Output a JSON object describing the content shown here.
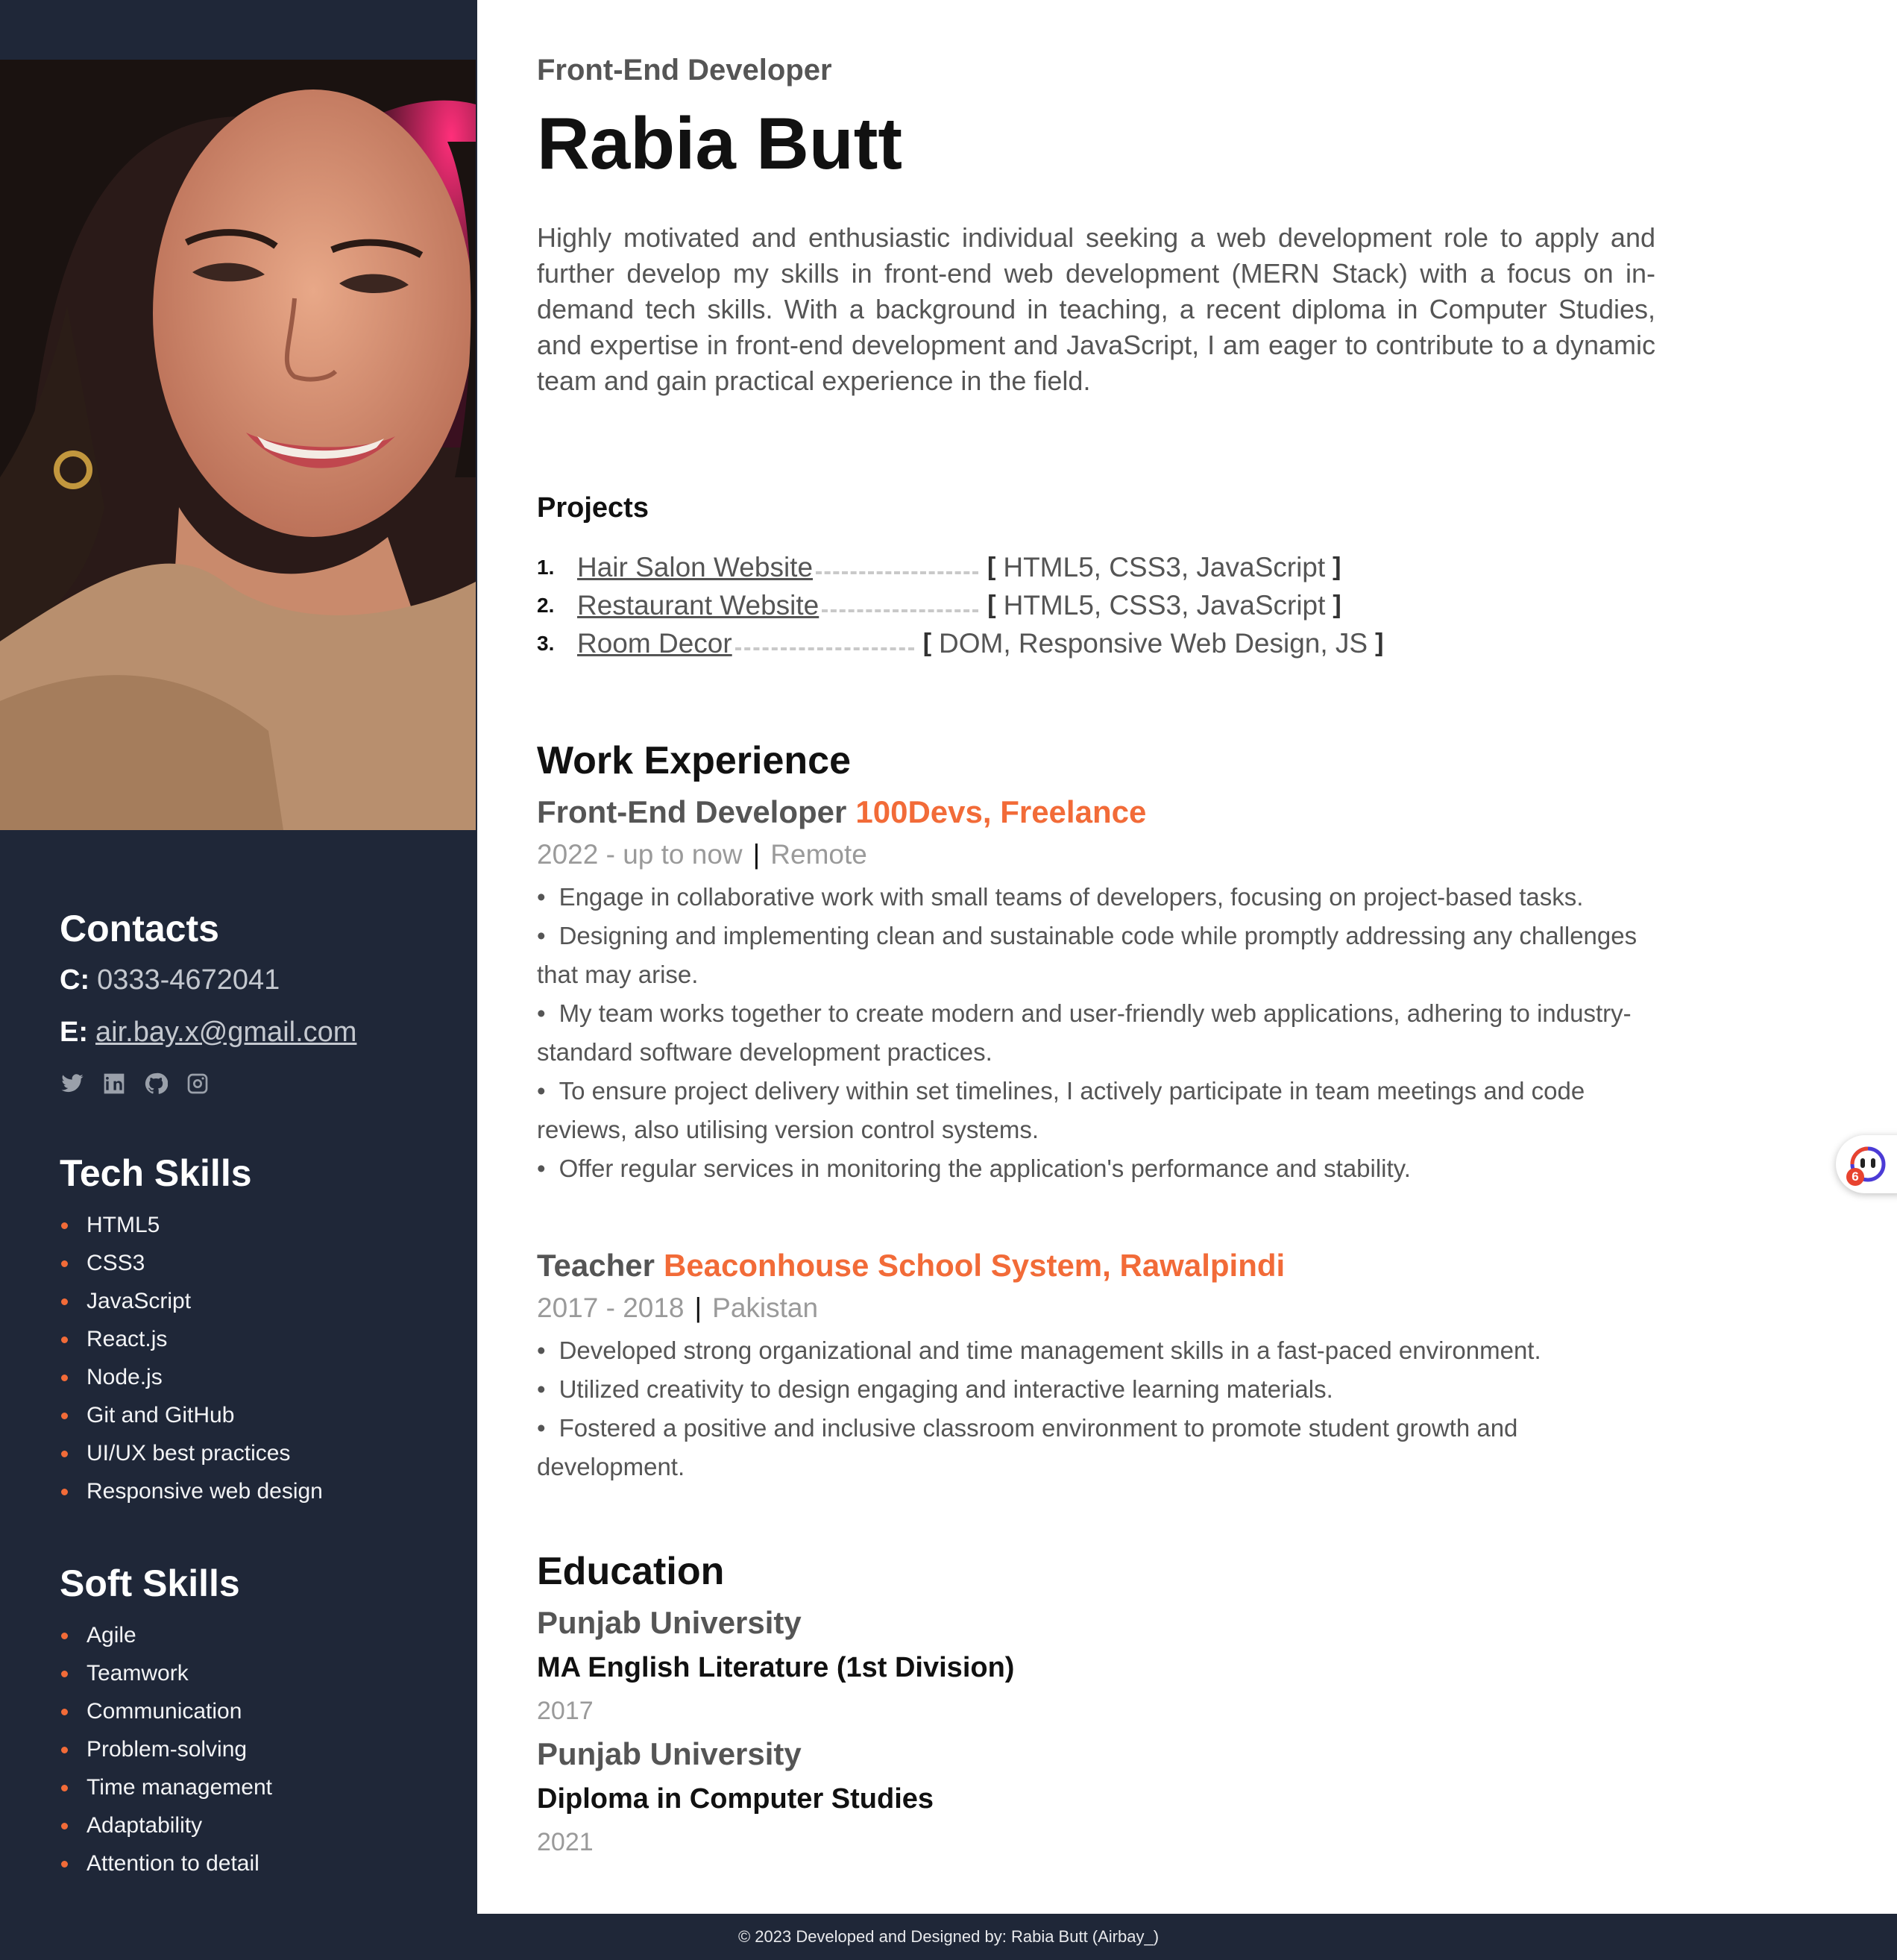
{
  "profile": {
    "role": "Front-End Developer",
    "name": "Rabia Butt",
    "summary": "Highly motivated and enthusiastic individual seeking a web development role to apply and further develop my skills in front-end web development (MERN Stack) with a focus on in-demand tech skills. With a background in teaching, a recent diploma in Computer Studies, and expertise in front-end development and JavaScript, I am eager to contribute to a dynamic team and gain practical experience in the field.",
    "photo_icon": "profile-photo"
  },
  "contacts": {
    "heading": "Contacts",
    "phone_label": "C:",
    "phone": "0333-4672041",
    "email_label": "E:",
    "email": "air.bay.x@gmail.com",
    "social_icons": [
      "twitter-icon",
      "linkedin-icon",
      "github-icon",
      "instagram-icon"
    ]
  },
  "tech_skills": {
    "heading": "Tech Skills",
    "items": [
      "HTML5",
      "CSS3",
      "JavaScript",
      "React.js",
      "Node.js",
      "Git and GitHub",
      "UI/UX best practices",
      "Responsive web design"
    ]
  },
  "soft_skills": {
    "heading": "Soft Skills",
    "items": [
      "Agile",
      "Teamwork",
      "Communication",
      "Problem-solving",
      "Time management",
      "Adaptability",
      "Attention to detail"
    ]
  },
  "projects": {
    "heading": "Projects",
    "items": [
      {
        "num": "1.",
        "name": "Hair Salon Website",
        "open": "[",
        "tech": "HTML5, CSS3, JavaScript",
        "close": "]"
      },
      {
        "num": "2.",
        "name": "Restaurant Website",
        "open": "[",
        "tech": "HTML5, CSS3, JavaScript",
        "close": "]"
      },
      {
        "num": "3.",
        "name": "Room Decor",
        "open": "[",
        "tech": "DOM, Responsive Web Design, JS",
        "close": "]"
      }
    ]
  },
  "work": {
    "heading": "Work Experience",
    "jobs": [
      {
        "title": "Front-End Developer",
        "company": "100Devs, Freelance",
        "period": "2022 - up to now",
        "sep": "|",
        "location": "Remote",
        "bullets": [
          "Engage in collaborative work with small teams of developers, focusing on project-based tasks.",
          "Designing and implementing clean and sustainable code while promptly addressing any challenges that may arise.",
          "My team works together to create modern and user-friendly web applications, adhering to industry-standard software development practices.",
          "To ensure project delivery within set timelines, I actively participate in team meetings and code reviews, also utilising version control systems.",
          "Offer regular services in monitoring the application's performance and stability."
        ]
      },
      {
        "title": "Teacher",
        "company": "Beaconhouse School System, Rawalpindi",
        "period": "2017 - 2018",
        "sep": "|",
        "location": "Pakistan",
        "bullets": [
          "Developed strong organizational and time management skills in a fast-paced environment.",
          "Utilized creativity to design engaging and interactive learning materials.",
          "Fostered a positive and inclusive classroom environment to promote student growth and development."
        ]
      }
    ]
  },
  "education": {
    "heading": "Education",
    "items": [
      {
        "school": "Punjab University",
        "degree": "MA English Literature (1st Division)",
        "year": "2017"
      },
      {
        "school": "Punjab University",
        "degree": "Diploma in Computer Studies",
        "year": "2021"
      }
    ]
  },
  "footer": {
    "text": "© 2023 Developed and Designed by: Rabia Butt (Airbay_)"
  },
  "widget": {
    "icon": "assistant-extension-icon",
    "badge": "6"
  },
  "colors": {
    "sidebar_bg": "#1f2738",
    "accent": "#f26b38",
    "text_gray": "#555555",
    "muted_gray": "#9a9a9a"
  }
}
